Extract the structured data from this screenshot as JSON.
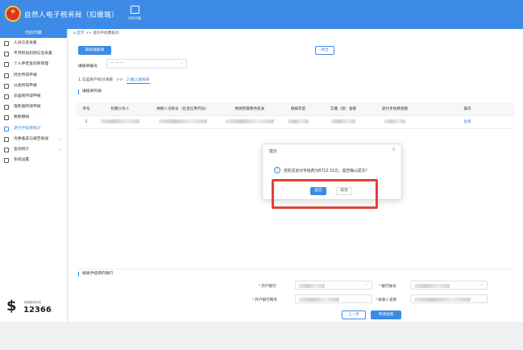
{
  "header": {
    "title": "自然人电子税务局（扣缴端）",
    "tool_label": "代扣代缴"
  },
  "sidebar": {
    "head": "代扣代缴",
    "items": [
      {
        "label": "人员信息采集",
        "icon": "person-icon"
      },
      {
        "label": "专项附加扣除信息采集",
        "icon": "id-card-icon"
      },
      {
        "label": "个人养老金扣除管理",
        "icon": "document-icon"
      },
      {
        "label": "综合所得申报",
        "icon": "grid-icon"
      },
      {
        "label": "分类所得申报",
        "icon": "circle-icon"
      },
      {
        "label": "非居民所得申报",
        "icon": "person-icon"
      },
      {
        "label": "限售股所得申报",
        "icon": "chart-icon"
      },
      {
        "label": "税款缴纳",
        "icon": "folder-icon"
      },
      {
        "label": "退付手续费核对",
        "icon": "document-icon"
      },
      {
        "label": "优惠备案与报告报送",
        "icon": "document-icon"
      },
      {
        "label": "查询统计",
        "icon": "search-icon"
      },
      {
        "label": "系统设置",
        "icon": "gear-icon"
      }
    ],
    "active_index": 8,
    "hotline_small": "纳税服务热线",
    "hotline_number": "12366"
  },
  "main": {
    "breadcrumb_home": "首页",
    "breadcrumb_sep": ">>",
    "breadcrumb_current": "退付手续费核对",
    "get_report_button": "获取填报单",
    "export_button": "导出",
    "report_no_label": "填报单编号",
    "report_no_value": "— — —",
    "step1": "1.勾选单户核对清册",
    "step_sep": ">>",
    "step2": "2.确认填报单",
    "section_title": "填报单列表",
    "table": {
      "headers": [
        "序号",
        "扣缴义务人",
        "纳税人识别号（社会信用代码）",
        "税款所属税务机关",
        "填报年度",
        "实缴（退）金额",
        "退付手续费金额",
        "操作"
      ],
      "rows": [
        {
          "index": "1",
          "action": "查看"
        }
      ]
    },
    "bottom_title": "接收手续费的银行",
    "bank_label": "开户银行",
    "account_label": "银行账号",
    "branch_label": "开户银行网点",
    "payee_label": "收款人名称",
    "prev_button": "上一步",
    "apply_button": "申请退库"
  },
  "dialog": {
    "title": "提示",
    "close": "×",
    "info_symbol": "i",
    "message": "您的应退付手续费为8722.31元，是否确认提交？",
    "ok": "提交",
    "cancel": "取消"
  },
  "colors": {
    "primary": "#3d8be6",
    "highlight": "#e2403a"
  }
}
